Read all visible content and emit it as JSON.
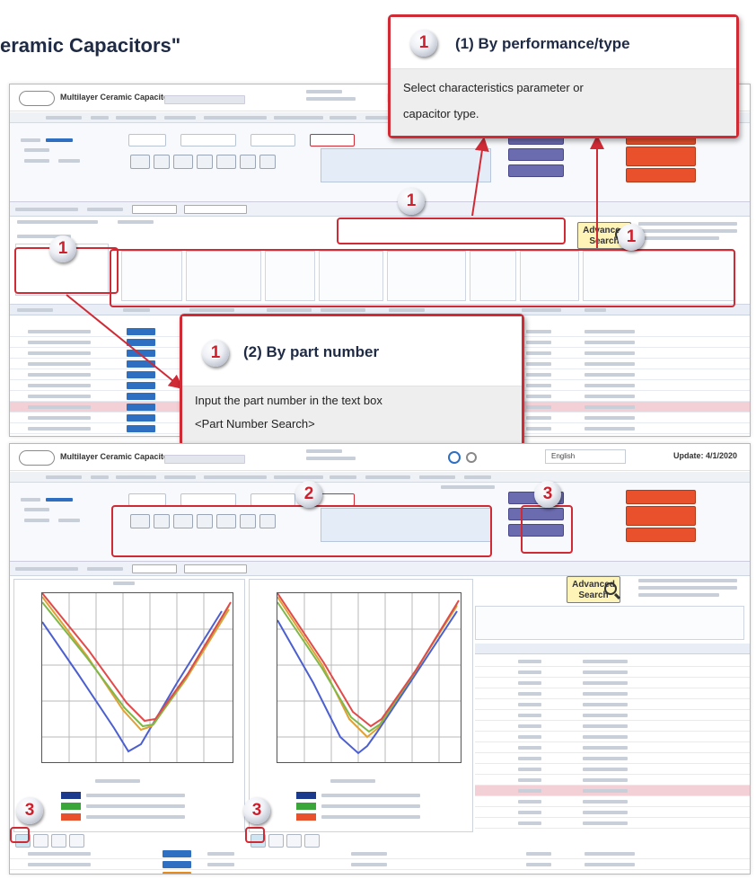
{
  "heading": "eramic Capacitors\"",
  "screenshot1": {
    "app_title": "Multilayer Ceramic Capacitors",
    "advanced_search": "Advanced Search"
  },
  "screenshot2": {
    "app_title": "Multilayer Ceramic Capacitors",
    "update": "Update: 4/1/2020",
    "language": "English",
    "advanced_search": "Advanced Search"
  },
  "callouts": {
    "by_performance": {
      "title": "(1) By performance/type",
      "lines": [
        "Select characteristics parameter or",
        "capacitor type."
      ]
    },
    "by_part_number": {
      "title": "(2) By part number",
      "lines": [
        "Input the part number in the text box",
        "<Part Number Search>"
      ]
    }
  },
  "badges": {
    "one": "1",
    "two": "2",
    "three": "3"
  },
  "colors": {
    "accent_red": "#d02a35",
    "heading_navy": "#1f2a44",
    "status_blue": "#2e6fc2",
    "spice_purple": "#6b6bb0",
    "action_orange": "#e8512c",
    "highlight_row": "#f3d0d6",
    "plot_series": [
      "#4c5fd0",
      "#e0a038",
      "#7fb84a",
      "#e24a4a"
    ]
  },
  "icons": [
    "logo-icon",
    "search-icon",
    "magnifier-icon",
    "chart-icon",
    "table-icon",
    "gear-icon"
  ]
}
